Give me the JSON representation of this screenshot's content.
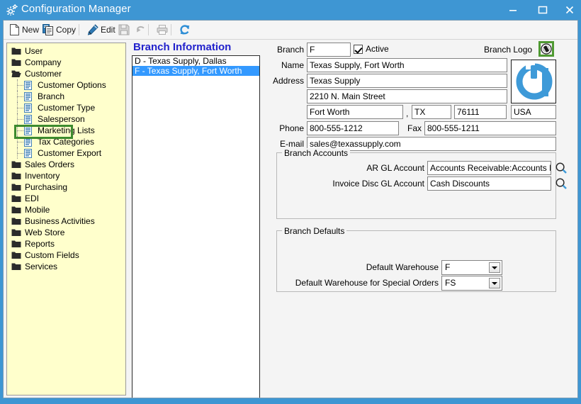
{
  "window": {
    "title": "Configuration Manager",
    "icon": "gears-icon",
    "accent_color": "#3e96d3",
    "controls": {
      "minimize": "minimize-icon",
      "maximize": "maximize-icon",
      "close": "close-icon"
    }
  },
  "toolbar": {
    "items": [
      {
        "label": "New",
        "icon": "new-page-icon",
        "enabled": true
      },
      {
        "label": "Copy",
        "icon": "copy-icon",
        "enabled": true
      },
      {
        "label": "Edit",
        "icon": "pencil-icon",
        "enabled": true
      },
      {
        "label": "",
        "icon": "save-icon",
        "enabled": false
      },
      {
        "label": "",
        "icon": "undo-icon",
        "enabled": false
      },
      {
        "label": "",
        "icon": "print-icon",
        "enabled": false
      },
      {
        "label": "",
        "icon": "refresh-icon",
        "enabled": true
      }
    ]
  },
  "sidebar": {
    "background_color": "#ffffcc",
    "highlight_color": "#3d8b2e",
    "items": [
      {
        "label": "User",
        "level": 0,
        "icon": "folder-icon",
        "expanded": false
      },
      {
        "label": "Company",
        "level": 0,
        "icon": "folder-icon",
        "expanded": false
      },
      {
        "label": "Customer",
        "level": 0,
        "icon": "folder-open-icon",
        "expanded": true
      },
      {
        "label": "Customer Options",
        "level": 1,
        "icon": "document-icon"
      },
      {
        "label": "Branch",
        "level": 1,
        "icon": "document-icon",
        "highlighted": true
      },
      {
        "label": "Customer Type",
        "level": 1,
        "icon": "document-icon"
      },
      {
        "label": "Salesperson",
        "level": 1,
        "icon": "document-icon"
      },
      {
        "label": "Marketing Lists",
        "level": 1,
        "icon": "document-icon"
      },
      {
        "label": "Tax Categories",
        "level": 1,
        "icon": "document-icon"
      },
      {
        "label": "Customer Export",
        "level": 1,
        "icon": "document-icon"
      },
      {
        "label": "Sales Orders",
        "level": 0,
        "icon": "folder-icon",
        "expanded": false
      },
      {
        "label": "Inventory",
        "level": 0,
        "icon": "folder-icon",
        "expanded": false
      },
      {
        "label": "Purchasing",
        "level": 0,
        "icon": "folder-icon",
        "expanded": false
      },
      {
        "label": "EDI",
        "level": 0,
        "icon": "folder-icon",
        "expanded": false
      },
      {
        "label": "Mobile",
        "level": 0,
        "icon": "folder-icon",
        "expanded": false
      },
      {
        "label": "Business Activities",
        "level": 0,
        "icon": "folder-icon",
        "expanded": false
      },
      {
        "label": "Web Store",
        "level": 0,
        "icon": "folder-icon",
        "expanded": false
      },
      {
        "label": "Reports",
        "level": 0,
        "icon": "folder-icon",
        "expanded": false
      },
      {
        "label": "Custom Fields",
        "level": 0,
        "icon": "folder-icon",
        "expanded": false
      },
      {
        "label": "Services",
        "level": 0,
        "icon": "folder-icon",
        "expanded": false
      }
    ]
  },
  "panel": {
    "title": "Branch Information",
    "title_color": "#2222cc"
  },
  "branch_list": {
    "items": [
      {
        "label": "D - Texas Supply, Dallas",
        "selected": false
      },
      {
        "label": "F - Texas Supply, Fort Worth",
        "selected": true
      }
    ],
    "selection_color": "#3399ff"
  },
  "form": {
    "branch_label": "Branch",
    "branch_value": "F",
    "active_label": "Active",
    "active_checked": true,
    "logo_label": "Branch Logo",
    "logo_button_icon": "aperture-icon",
    "logo_image_icon": "power-a-logo",
    "logo_color": "#3e9ad8",
    "name_label": "Name",
    "name_value": "Texas Supply, Fort Worth",
    "address_label": "Address",
    "address1_value": "Texas Supply",
    "address2_value": "2210 N. Main Street",
    "city_value": "Fort Worth",
    "comma": ",",
    "state_value": "TX",
    "zip_value": "76111",
    "country_value": "USA",
    "phone_label": "Phone",
    "phone_value": "800-555-1212",
    "fax_label": "Fax",
    "fax_value": "800-555-1211",
    "email_label": "E-mail",
    "email_value": "sales@texassupply.com",
    "accounts_group": {
      "title": "Branch Accounts",
      "ar_label": "AR GL Account",
      "ar_value": "Accounts Receivable:Accounts Recei",
      "ar_search_icon": "magnifier-icon",
      "disc_label": "Invoice Disc GL Account",
      "disc_value": "Cash Discounts",
      "disc_search_icon": "magnifier-icon"
    },
    "defaults_group": {
      "title": "Branch Defaults",
      "warehouse_label": "Default Warehouse",
      "warehouse_value": "F",
      "special_label": "Default Warehouse for Special Orders",
      "special_value": "FS"
    }
  }
}
